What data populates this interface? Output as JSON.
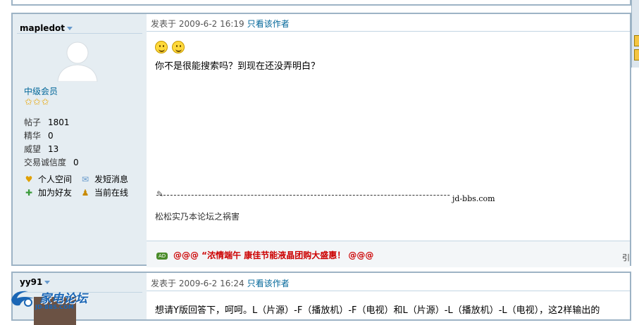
{
  "post1": {
    "author": {
      "name": "mapledot",
      "group": "中级会员",
      "stars": "✩✩✩",
      "stats": [
        {
          "label": "帖子",
          "value": "1801"
        },
        {
          "label": "精华",
          "value": "0"
        },
        {
          "label": "威望",
          "value": "13"
        },
        {
          "label": "交易诚信度",
          "value": "0"
        }
      ],
      "actions": {
        "space": "个人空间",
        "message": "发短消息",
        "add_friend": "加为好友",
        "online": "当前在线"
      }
    },
    "header": {
      "posted_at": "发表于  2009-6-2 16:19",
      "only_author": "只看该作者"
    },
    "body": "你不是很能搜索吗？到现在还没弄明白？",
    "signature": {
      "site": "jd-bbs.com",
      "text": "松松实乃本论坛之祸害"
    },
    "ad": {
      "tag": "AD",
      "text": "@@@ “浓情端午 康佳节能液晶团购大盛惠！ @@@"
    },
    "right_snippet": "引"
  },
  "post2": {
    "author_name": "yy91",
    "header": {
      "posted_at": "发表于  2009-6-2 16:24",
      "only_author": "只看该作者"
    },
    "body": "想请Y版回答下，呵呵。L（片源）-F（播放机）-F（电视）和L（片源）-L（播放机）-L（电视），这2样输出的"
  },
  "logo": {
    "title": "家电论坛",
    "sub": "JD-BBS.COM"
  },
  "colors": {
    "border": "#9db3c5",
    "left_bg": "#e5edf2",
    "link": "#006699",
    "ad_red": "#cc0000"
  }
}
